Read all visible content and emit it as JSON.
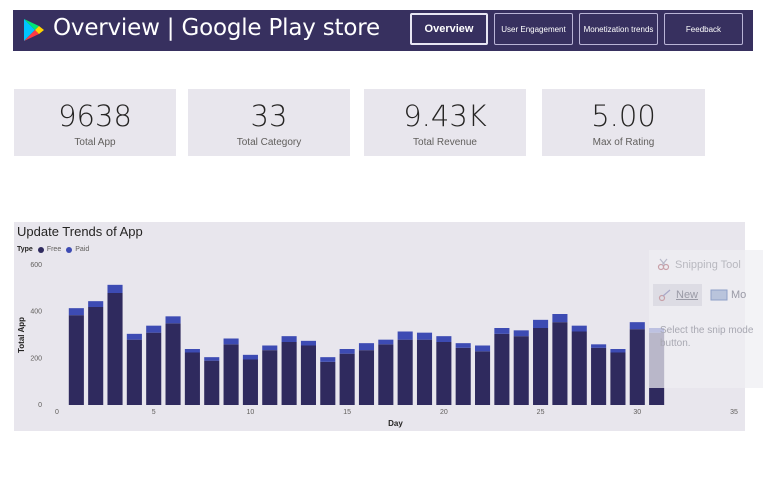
{
  "header": {
    "title": "Overview | Google Play store",
    "nav": [
      {
        "label": "Overview",
        "active": true
      },
      {
        "label": "User Engagement",
        "active": false
      },
      {
        "label": "Monetization trends",
        "active": false
      },
      {
        "label": "Feedback",
        "active": false
      }
    ]
  },
  "kpis": [
    {
      "value": "9638",
      "label": "Total App"
    },
    {
      "value": "33",
      "label": "Total Category"
    },
    {
      "value": "9.43K",
      "label": "Total Revenue"
    },
    {
      "value": "5.00",
      "label": "Max of Rating"
    }
  ],
  "chart": {
    "title": "Update Trends of App",
    "legend_title": "Type",
    "colors": {
      "free": "#2f2a5e",
      "paid": "#3d4bb3",
      "panel": "#e8e6ed"
    }
  },
  "chart_data": {
    "type": "bar",
    "stacked": true,
    "title": "Update Trends of App",
    "xlabel": "Day",
    "ylabel": "Total App",
    "legend_title": "Type",
    "xlim": [
      0,
      35
    ],
    "ylim": [
      0,
      600
    ],
    "xticks": [
      "0",
      "5",
      "10",
      "15",
      "20",
      "25",
      "30",
      "35"
    ],
    "yticks": [
      "0",
      "200",
      "400",
      "600"
    ],
    "categories": [
      1,
      2,
      3,
      4,
      5,
      6,
      7,
      8,
      9,
      10,
      11,
      12,
      13,
      14,
      15,
      16,
      17,
      18,
      19,
      20,
      21,
      22,
      23,
      24,
      25,
      26,
      27,
      28,
      29,
      30,
      31
    ],
    "series": [
      {
        "name": "Free",
        "values": [
          385,
          420,
          480,
          280,
          310,
          350,
          225,
          190,
          260,
          195,
          235,
          270,
          255,
          185,
          220,
          235,
          260,
          280,
          280,
          270,
          245,
          230,
          305,
          295,
          330,
          355,
          315,
          245,
          225,
          325,
          310
        ]
      },
      {
        "name": "Paid",
        "values": [
          30,
          25,
          35,
          25,
          30,
          30,
          15,
          15,
          25,
          20,
          20,
          25,
          20,
          20,
          20,
          30,
          20,
          35,
          30,
          25,
          20,
          25,
          25,
          25,
          35,
          35,
          25,
          15,
          15,
          30,
          20
        ]
      }
    ]
  },
  "snipping_tool": {
    "title": "Snipping Tool",
    "new_label": "New",
    "mode_label": "Mo",
    "description": "Select the snip mode button."
  }
}
